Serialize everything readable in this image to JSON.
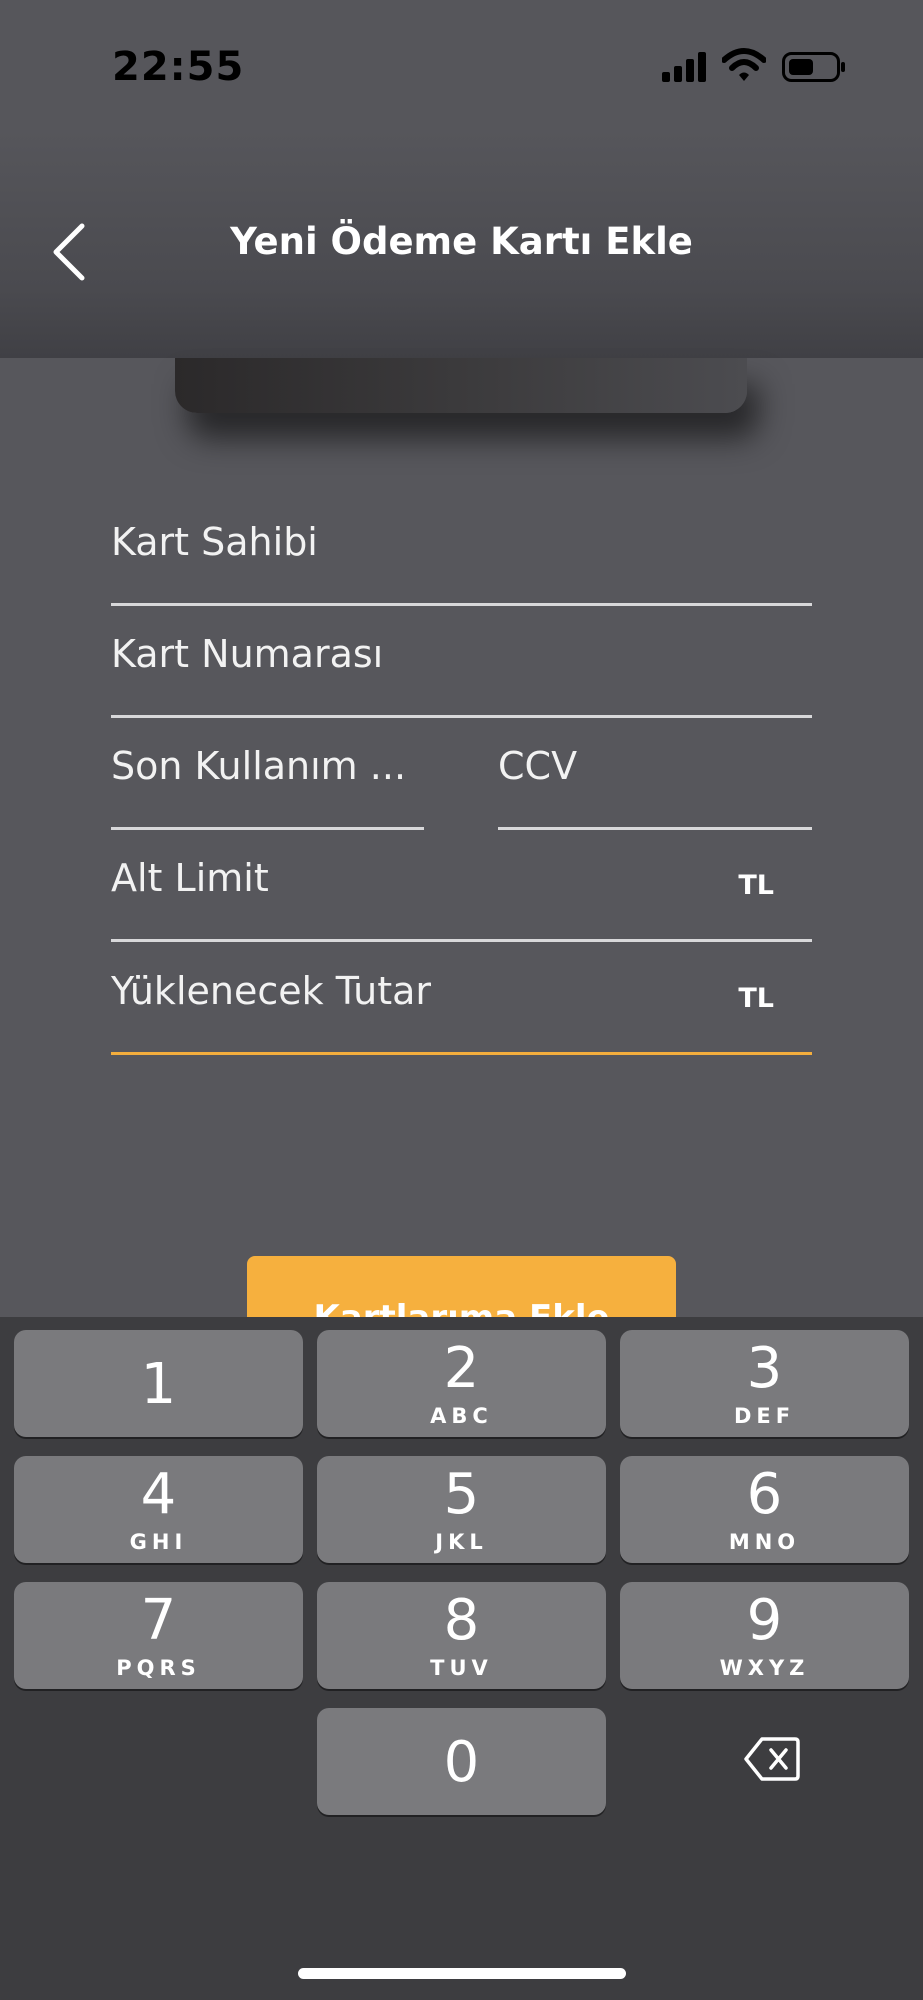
{
  "status_bar": {
    "time": "22:55",
    "icons": [
      "signal-icon",
      "wifi-icon",
      "battery-icon"
    ]
  },
  "nav": {
    "back_icon": "chevron-left-icon",
    "title": "Yeni Ödeme Kartı Ekle"
  },
  "form": {
    "card_holder": {
      "placeholder": "Kart Sahibi"
    },
    "card_number": {
      "placeholder": "Kart Numarası"
    },
    "expiry": {
      "placeholder": "Son Kullanım ..."
    },
    "ccv": {
      "placeholder": "CCV"
    },
    "lower_limit": {
      "placeholder": "Alt Limit",
      "suffix": "TL"
    },
    "load_amount": {
      "placeholder": "Yüklenecek Tutar",
      "suffix": "TL"
    }
  },
  "actions": {
    "add_to_cards_label": "Kartlarıma Ekle"
  },
  "keyboard": {
    "keys": [
      {
        "digit": "1",
        "letters": ""
      },
      {
        "digit": "2",
        "letters": "ABC"
      },
      {
        "digit": "3",
        "letters": "DEF"
      },
      {
        "digit": "4",
        "letters": "GHI"
      },
      {
        "digit": "5",
        "letters": "JKL"
      },
      {
        "digit": "6",
        "letters": "MNO"
      },
      {
        "digit": "7",
        "letters": "PQRS"
      },
      {
        "digit": "8",
        "letters": "TUV"
      },
      {
        "digit": "9",
        "letters": "WXYZ"
      },
      {
        "digit": "0",
        "letters": ""
      }
    ],
    "delete_icon": "backspace-icon"
  },
  "colors": {
    "background": "#57575c",
    "accent": "#f6b03e",
    "key": "#7a7a7d",
    "keyboard_bg": "#3d3d40"
  }
}
